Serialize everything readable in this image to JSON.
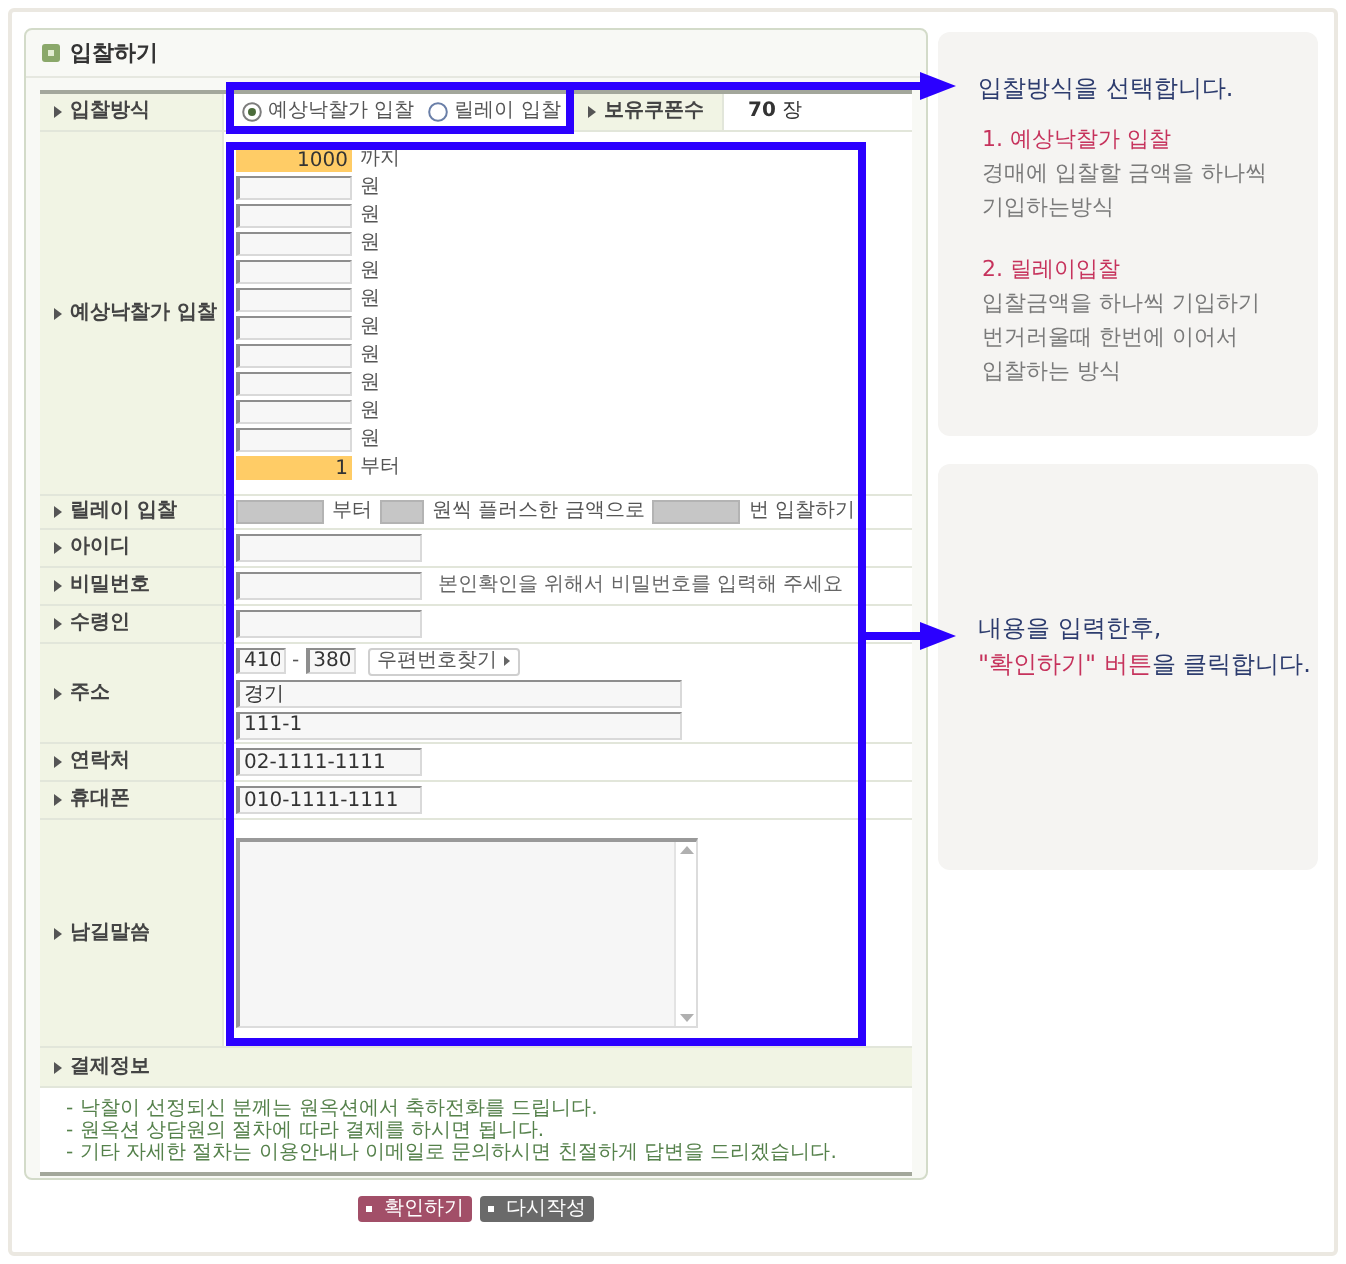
{
  "panel": {
    "title": "입찰하기"
  },
  "form": {
    "bid_method": {
      "label": "입찰방식",
      "options": [
        {
          "label": "예상낙찰가 입찰",
          "selected": true
        },
        {
          "label": "릴레이 입찰",
          "selected": false
        }
      ]
    },
    "coupons": {
      "label": "보유쿠폰수",
      "value": "**70** 장"
    },
    "estimated_bid": {
      "label": "예상낙찰가 입찰",
      "rows": [
        {
          "kind": "limit",
          "value": "1000",
          "unit": "까지"
        },
        {
          "kind": "step",
          "unit": "원"
        },
        {
          "kind": "step",
          "unit": "원"
        },
        {
          "kind": "step",
          "unit": "원"
        },
        {
          "kind": "step",
          "unit": "원"
        },
        {
          "kind": "step",
          "unit": "원"
        },
        {
          "kind": "step",
          "unit": "원"
        },
        {
          "kind": "step",
          "unit": "원"
        },
        {
          "kind": "step",
          "unit": "원"
        },
        {
          "kind": "step",
          "unit": "원"
        },
        {
          "kind": "step",
          "unit": "원"
        },
        {
          "kind": "limit",
          "value": "1",
          "unit": "부터"
        }
      ]
    },
    "relay_bid": {
      "label": "릴레이 입찰",
      "disabled": true,
      "texts": [
        "부터",
        "원씩 플러스한 금액으로",
        "번 입찰하기"
      ]
    },
    "fields": [
      {
        "kind": "input",
        "label": "아이디"
      },
      {
        "kind": "input",
        "label": "비밀번호",
        "note": "본인확인을 위해서 비밀번호를 입력해 주세요"
      },
      {
        "kind": "input",
        "label": "수령인"
      },
      {
        "kind": "address",
        "label": "주소",
        "zip": [
          "410",
          "380"
        ],
        "zip_separator": "-",
        "button": "우편번호찾기",
        "lines": [
          "경기",
          "111-1"
        ]
      },
      {
        "kind": "input",
        "label": "연락처",
        "value": "02-1111-1111"
      },
      {
        "kind": "input",
        "label": "휴대폰",
        "value": "010-1111-1111"
      },
      {
        "kind": "textarea",
        "label": "남길말씀"
      }
    ]
  },
  "payment": {
    "title": "결제정보",
    "notes": [
      "- 낙찰이 선정되신 분께는 원옥션에서 축하전화를 드립니다.",
      "- 원옥션 상담원의 절차에 따라 결제를 하시면 됩니다.",
      "- 기타 자세한 절차는 이용안내나 이메일로 문의하시면 친절하게 답변을 드리겠습니다."
    ]
  },
  "buttons": [
    {
      "kind": "primary",
      "label": "확인하기"
    },
    {
      "kind": "secondary",
      "label": "다시작성"
    }
  ],
  "callouts": [
    {
      "title": "입찰방식을 선택합니다.",
      "items": [
        {
          "heading": "1. 예상낙찰가 입찰",
          "lines": [
            "경매에 입찰할 금액을 하나씩",
            "기입하는방식"
          ]
        },
        {
          "heading": "2. 릴레이입찰",
          "lines": [
            "입찰금액을 하나씩 기입하기",
            "번거러울때 한번에 이어서",
            "입찰하는 방식"
          ]
        }
      ]
    },
    {
      "lines": [
        {
          "segments": [
            {
              "text": "내용을 입력한후,",
              "highlight": false
            }
          ]
        },
        {
          "segments": [
            {
              "text": "\"확인하기\" 버튼",
              "highlight": true
            },
            {
              "text": "을 클릭합니다.",
              "highlight": false
            }
          ]
        }
      ]
    }
  ]
}
